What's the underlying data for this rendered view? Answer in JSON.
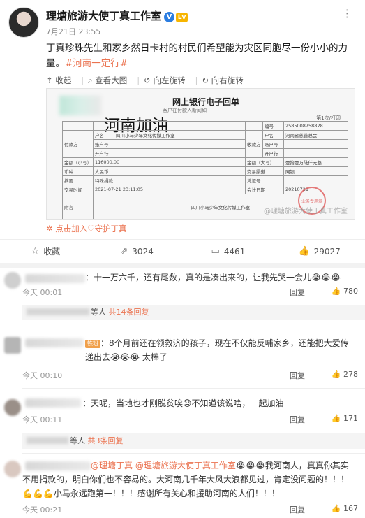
{
  "post": {
    "author": "理塘旅游大使丁真工作室",
    "verified_mark": "V",
    "level_badge": "Lv",
    "time": "7月21日 23:55",
    "text": "丁真珍珠先生和家乡然日卡村的村民们希望能为灾区同胞尽一份小小的力量。",
    "hashtag": "#河南一定行#"
  },
  "image_toolbar": {
    "collapse": "收起",
    "view_large": "查看大图",
    "rotate_left": "向左旋转",
    "rotate_right": "向右旋转"
  },
  "receipt": {
    "title": "网上银行电子回单",
    "subtitle": "客户在付款人新闻如",
    "overlay_text": "河南加油",
    "page_no": "第1次/打印",
    "serial_label": "编号",
    "serial_value": "2585008758828",
    "payer_label": "付款方",
    "payee_label": "收款方",
    "name_label": "户名",
    "payer_name": "四川小马少年文化传媒工作室",
    "payee_name": "河南省慈善总会",
    "account_label": "账户号",
    "bank_label": "开户行",
    "amount_small_label": "金额（小写）",
    "amount_small": "116000.00",
    "amount_big_label": "金额（大写）",
    "amount_big": "壹拾壹万陆仟元整",
    "currency_label": "币种",
    "currency": "人民币",
    "trade_channel_label": "交易渠道",
    "trade_channel": "网银",
    "purpose_label": "摘要",
    "purpose": "特殊捐款",
    "voucher_label": "凭证号",
    "trade_time_label": "交易时间",
    "trade_time": "2021-07-21 23:11:05",
    "acct_date_label": "会计日期",
    "acct_date": "20210721",
    "memo_label": "附言",
    "memo_value": "四川小马少年文化传媒工作室",
    "watermark": "@理塘旅游大使丁真工作室",
    "stamp_text": "业务专用章"
  },
  "guard_link": "点击加入♡守护丁真",
  "actions": {
    "favorite": "收藏",
    "repost": "3024",
    "comment": "4461",
    "like": "29027"
  },
  "comments": [
    {
      "text": "：十一万六千，还有尾数，真的是凑出来的，让我先哭一会儿😭😭😭",
      "time": "今天 00:01",
      "reply": "回复",
      "likes": "780",
      "more_prefix": "等人",
      "more_count": "共14条回复"
    },
    {
      "badge": "铁粉",
      "text": "：8个月前还在领救济的孩子，现在不仅能反哺家乡，还能把大爱传递出去😭😭😭 太棒了",
      "time": "今天 00:10",
      "reply": "回复",
      "likes": "278"
    },
    {
      "text": "：天呢，当地也才刚脱贫唉😓不知道该说啥，一起加油",
      "time": "今天 00:11",
      "reply": "回复",
      "likes": "171",
      "more_prefix": "等人",
      "more_count": "共3条回复"
    },
    {
      "mention1": "@理塘丁真",
      "mention2": "@理塘旅游大使丁真工作室",
      "text": "😭😭😭我河南人，真真你其实不用捐款的，明白你们也不容易的。大河南几千年大风大浪都见过，肯定没问题的！！！💪💪💪小马永远跑第一！！！感谢所有关心和援助河南的人们！！！",
      "time": "今天 00:21",
      "reply": "回复",
      "likes": "167"
    }
  ]
}
